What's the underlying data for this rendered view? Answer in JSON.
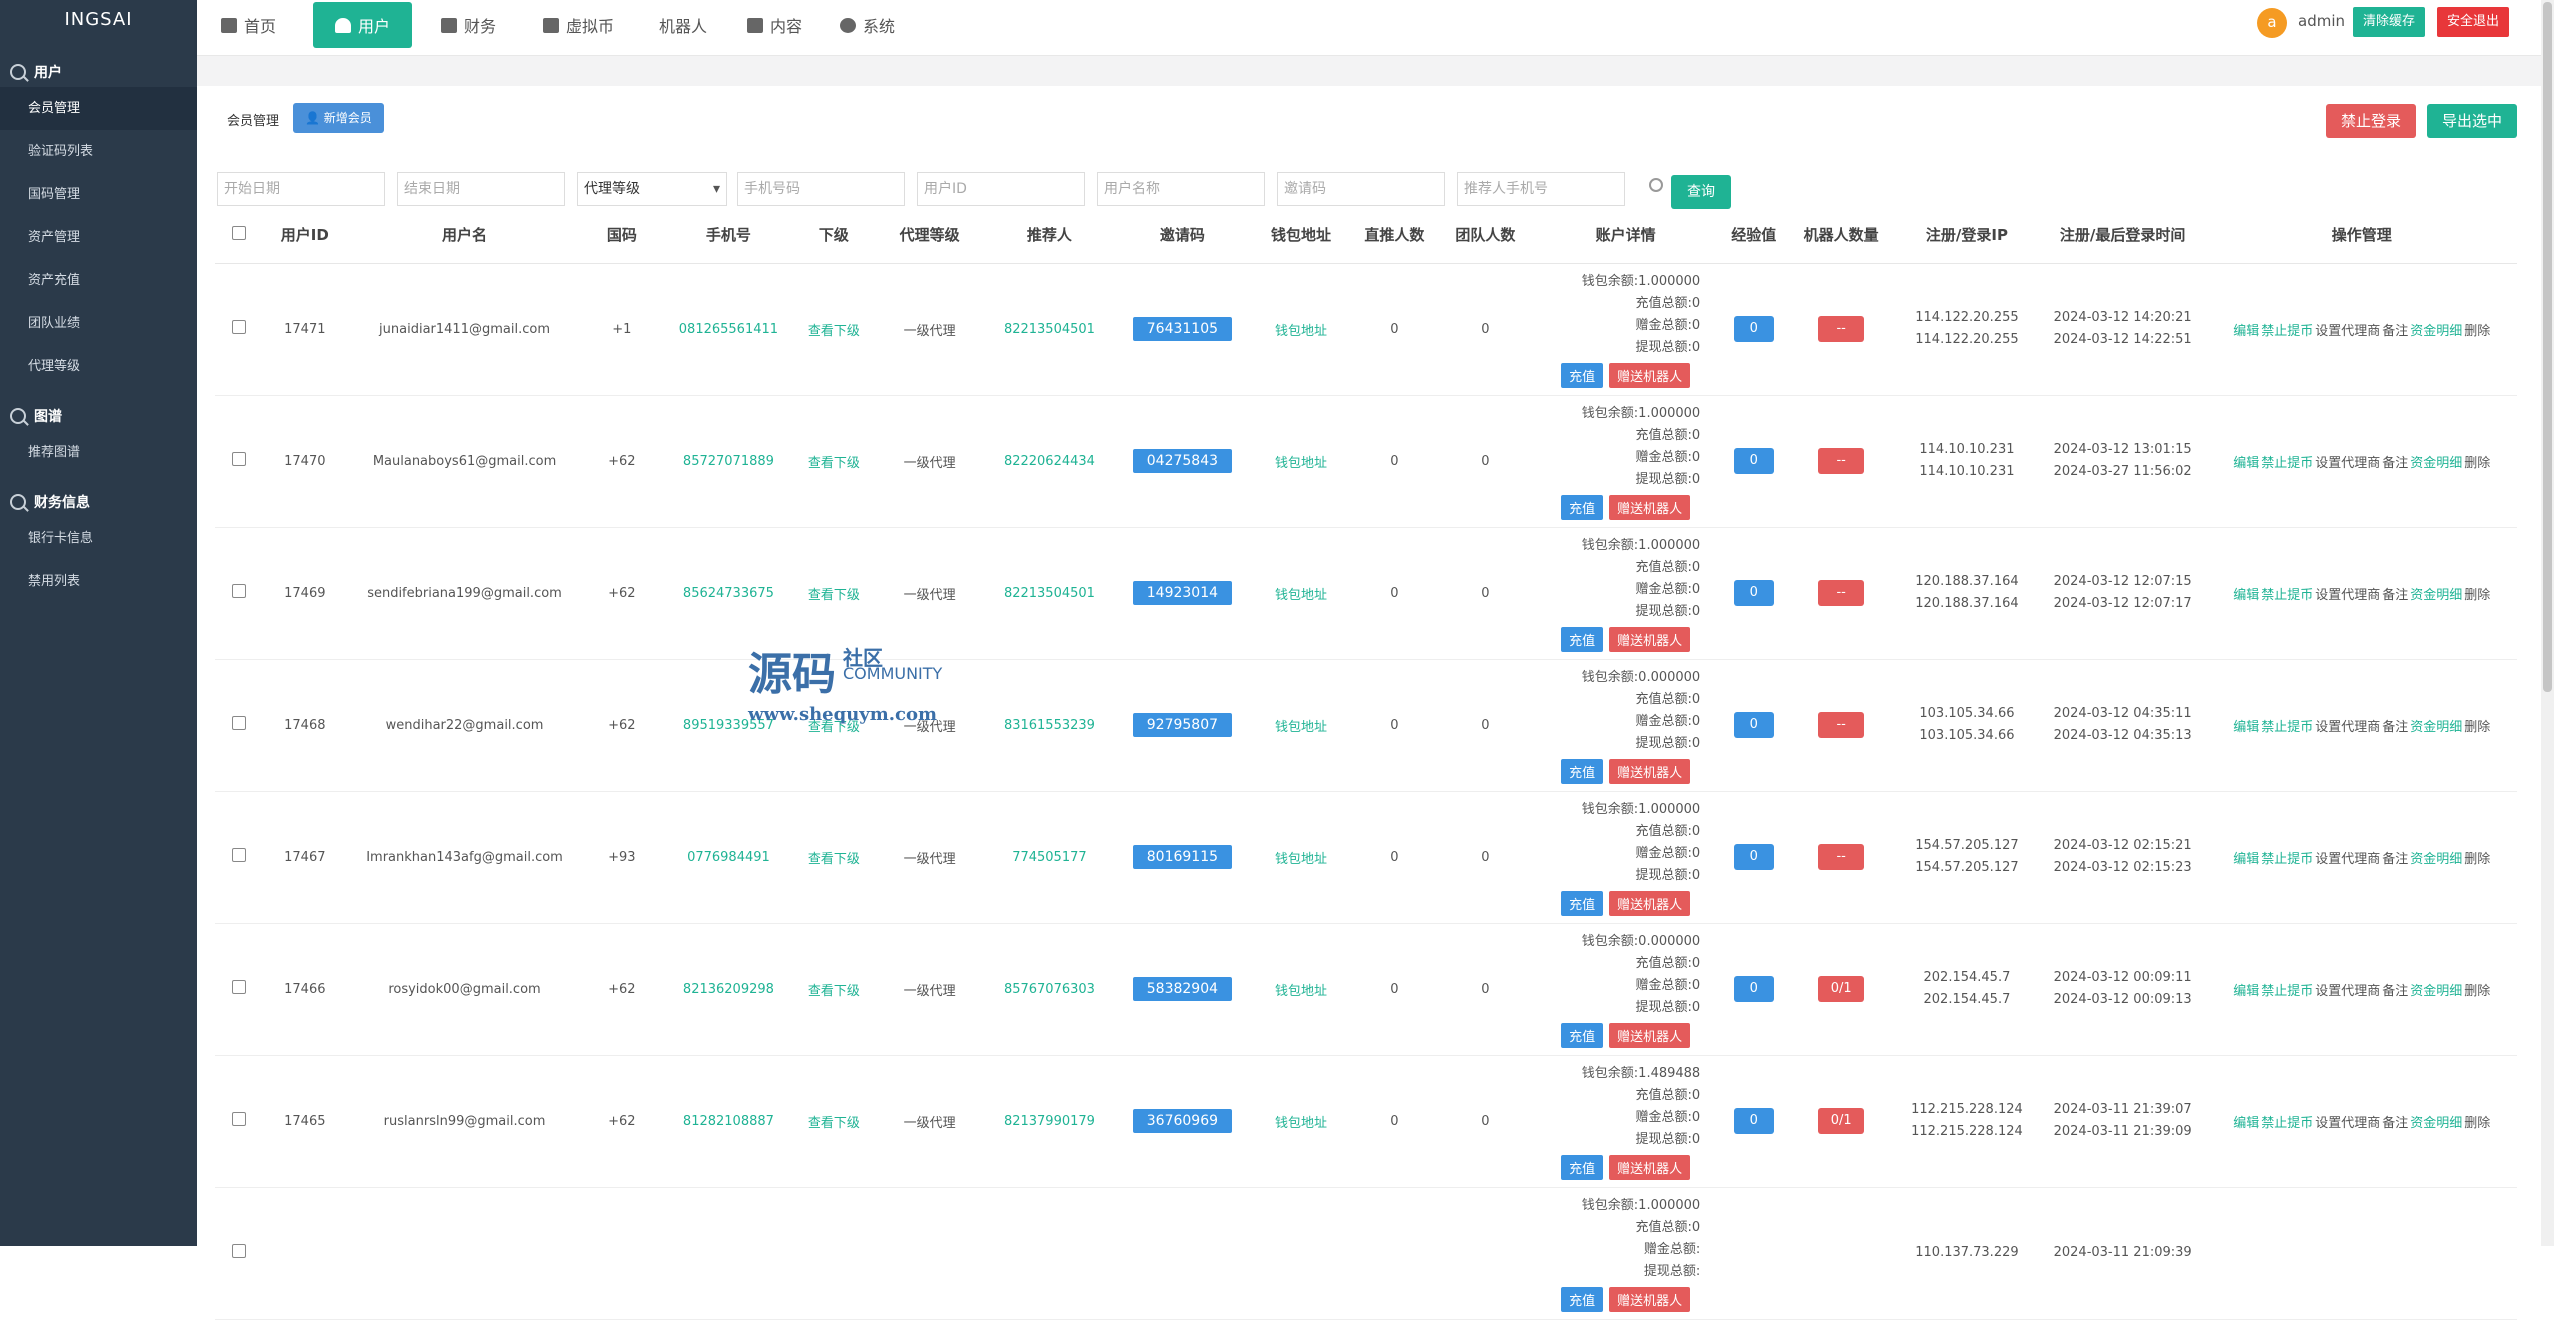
{
  "app": {
    "title": "INGSAI"
  },
  "sidebar": {
    "groups": [
      {
        "label": "用户",
        "items": [
          {
            "label": "会员管理",
            "active": true
          },
          {
            "label": "验证码列表"
          },
          {
            "label": "国码管理"
          },
          {
            "label": "资产管理"
          },
          {
            "label": "资产充值"
          },
          {
            "label": "团队业绩"
          },
          {
            "label": "代理等级"
          }
        ]
      },
      {
        "label": "图谱",
        "items": [
          {
            "label": "推荐图谱"
          }
        ]
      },
      {
        "label": "财务信息",
        "items": [
          {
            "label": "银行卡信息"
          },
          {
            "label": "禁用列表"
          }
        ]
      }
    ]
  },
  "topnav": {
    "items": [
      "首页",
      "用户",
      "财务",
      "虚拟币",
      "机器人",
      "内容",
      "系统"
    ],
    "active": 1
  },
  "header": {
    "avatar": "a",
    "user": "admin",
    "clear_cache": "清除缓存",
    "logout": "安全退出"
  },
  "page": {
    "title": "会员管理",
    "add_member": "新增会员",
    "ban_login": "禁止登录",
    "export": "导出选中"
  },
  "filters": {
    "start_date": "开始日期",
    "end_date": "结束日期",
    "agent_level": "代理等级",
    "phone": "手机号码",
    "user_id": "用户ID",
    "user_name": "用户名称",
    "invite": "邀请码",
    "ref_phone": "推荐人手机号",
    "query": "查询"
  },
  "table": {
    "headers": [
      "用户ID",
      "用户名",
      "国码",
      "手机号",
      "下级",
      "代理等级",
      "推荐人",
      "邀请码",
      "钱包地址",
      "直推人数",
      "团队人数",
      "账户详情",
      "经验值",
      "机器人数量",
      "注册/登录IP",
      "注册/最后登录时间",
      "操作管理"
    ],
    "wallet_labels": {
      "balance": "钱包余额:",
      "recharge": "充值总额:",
      "gift": "赠金总额:",
      "withdraw": "提现总额:"
    },
    "btn_recharge": "充值",
    "btn_gift_robot": "赠送机器人",
    "sub_link": "查看下级",
    "wallet_link": "钱包地址",
    "ops": [
      "编辑",
      "禁止提币",
      "设置代理商",
      "备注",
      "资金明细",
      "删除"
    ],
    "rows": [
      {
        "id": "17471",
        "name": "junaidiar1411@gmail.com",
        "cc": "+1",
        "phone": "081265561411",
        "level": "一级代理",
        "ref": "82213504501",
        "invite": "76431105",
        "direct": "0",
        "team": "0",
        "balance": "1.000000",
        "recharge": "0",
        "gift": "0",
        "withdraw": "0",
        "xp": "0",
        "robots": "--",
        "ip1": "114.122.20.255",
        "ip2": "114.122.20.255",
        "t1": "2024-03-12 14:20:21",
        "t2": "2024-03-12 14:22:51"
      },
      {
        "id": "17470",
        "name": "Maulanaboys61@gmail.com",
        "cc": "+62",
        "phone": "85727071889",
        "level": "一级代理",
        "ref": "82220624434",
        "invite": "04275843",
        "direct": "0",
        "team": "0",
        "balance": "1.000000",
        "recharge": "0",
        "gift": "0",
        "withdraw": "0",
        "xp": "0",
        "robots": "--",
        "ip1": "114.10.10.231",
        "ip2": "114.10.10.231",
        "t1": "2024-03-12 13:01:15",
        "t2": "2024-03-27 11:56:02"
      },
      {
        "id": "17469",
        "name": "sendifebriana199@gmail.com",
        "cc": "+62",
        "phone": "85624733675",
        "level": "一级代理",
        "ref": "82213504501",
        "invite": "14923014",
        "direct": "0",
        "team": "0",
        "balance": "1.000000",
        "recharge": "0",
        "gift": "0",
        "withdraw": "0",
        "xp": "0",
        "robots": "--",
        "ip1": "120.188.37.164",
        "ip2": "120.188.37.164",
        "t1": "2024-03-12 12:07:15",
        "t2": "2024-03-12 12:07:17"
      },
      {
        "id": "17468",
        "name": "wendihar22@gmail.com",
        "cc": "+62",
        "phone": "89519339557",
        "level": "一级代理",
        "ref": "83161553239",
        "invite": "92795807",
        "direct": "0",
        "team": "0",
        "balance": "0.000000",
        "recharge": "0",
        "gift": "0",
        "withdraw": "0",
        "xp": "0",
        "robots": "--",
        "ip1": "103.105.34.66",
        "ip2": "103.105.34.66",
        "t1": "2024-03-12 04:35:11",
        "t2": "2024-03-12 04:35:13"
      },
      {
        "id": "17467",
        "name": "Imrankhan143afg@gmail.com",
        "cc": "+93",
        "phone": "0776984491",
        "level": "一级代理",
        "ref": "774505177",
        "invite": "80169115",
        "direct": "0",
        "team": "0",
        "balance": "1.000000",
        "recharge": "0",
        "gift": "0",
        "withdraw": "0",
        "xp": "0",
        "robots": "--",
        "ip1": "154.57.205.127",
        "ip2": "154.57.205.127",
        "t1": "2024-03-12 02:15:21",
        "t2": "2024-03-12 02:15:23"
      },
      {
        "id": "17466",
        "name": "rosyidok00@gmail.com",
        "cc": "+62",
        "phone": "82136209298",
        "level": "一级代理",
        "ref": "85767076303",
        "invite": "58382904",
        "direct": "0",
        "team": "0",
        "balance": "0.000000",
        "recharge": "0",
        "gift": "0",
        "withdraw": "0",
        "xp": "0",
        "robots": "0/1",
        "ip1": "202.154.45.7",
        "ip2": "202.154.45.7",
        "t1": "2024-03-12 00:09:11",
        "t2": "2024-03-12 00:09:13"
      },
      {
        "id": "17465",
        "name": "ruslanrsln99@gmail.com",
        "cc": "+62",
        "phone": "81282108887",
        "level": "一级代理",
        "ref": "82137990179",
        "invite": "36760969",
        "direct": "0",
        "team": "0",
        "balance": "1.489488",
        "recharge": "0",
        "gift": "0",
        "withdraw": "0",
        "xp": "0",
        "robots": "0/1",
        "ip1": "112.215.228.124",
        "ip2": "112.215.228.124",
        "t1": "2024-03-11 21:39:07",
        "t2": "2024-03-11 21:39:09"
      },
      {
        "id": "",
        "name": "",
        "cc": "",
        "phone": "",
        "level": "",
        "ref": "",
        "invite": "",
        "direct": "",
        "team": "",
        "balance": "1.000000",
        "recharge": "0",
        "gift": "",
        "withdraw": "",
        "xp": "",
        "robots": "",
        "ip1": "110.137.73.229",
        "ip2": "",
        "t1": "2024-03-11 21:09:39",
        "t2": ""
      }
    ]
  },
  "watermark": {
    "cn": "源码",
    "sub1": "社区",
    "sub2": "COMMUNITY",
    "url": "www.shequym.com"
  },
  "colors": {
    "sidebar": "#2b3a4a",
    "primary": "#1fb394",
    "blue": "#3a92e1",
    "red": "#e45b5b"
  }
}
